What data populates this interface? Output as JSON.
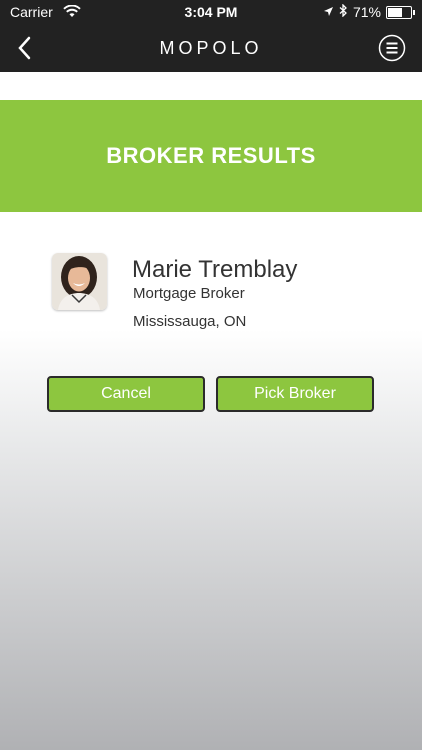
{
  "status_bar": {
    "carrier": "Carrier",
    "time": "3:04 PM",
    "battery": "71%",
    "battery_level": 0.71,
    "icons": [
      "wifi-icon",
      "location-arrow-icon",
      "bluetooth-icon",
      "battery-icon"
    ]
  },
  "nav": {
    "brand": "MOPOLO",
    "back_icon": "chevron-left-icon",
    "menu_icon": "menu-circle-icon"
  },
  "banner": {
    "title": "BROKER RESULTS",
    "color": "#8dc63f"
  },
  "broker": {
    "name": "Marie Tremblay",
    "title": "Mortgage Broker",
    "location": "Mississauga, ON"
  },
  "actions": {
    "cancel_label": "Cancel",
    "pick_label": "Pick Broker"
  }
}
